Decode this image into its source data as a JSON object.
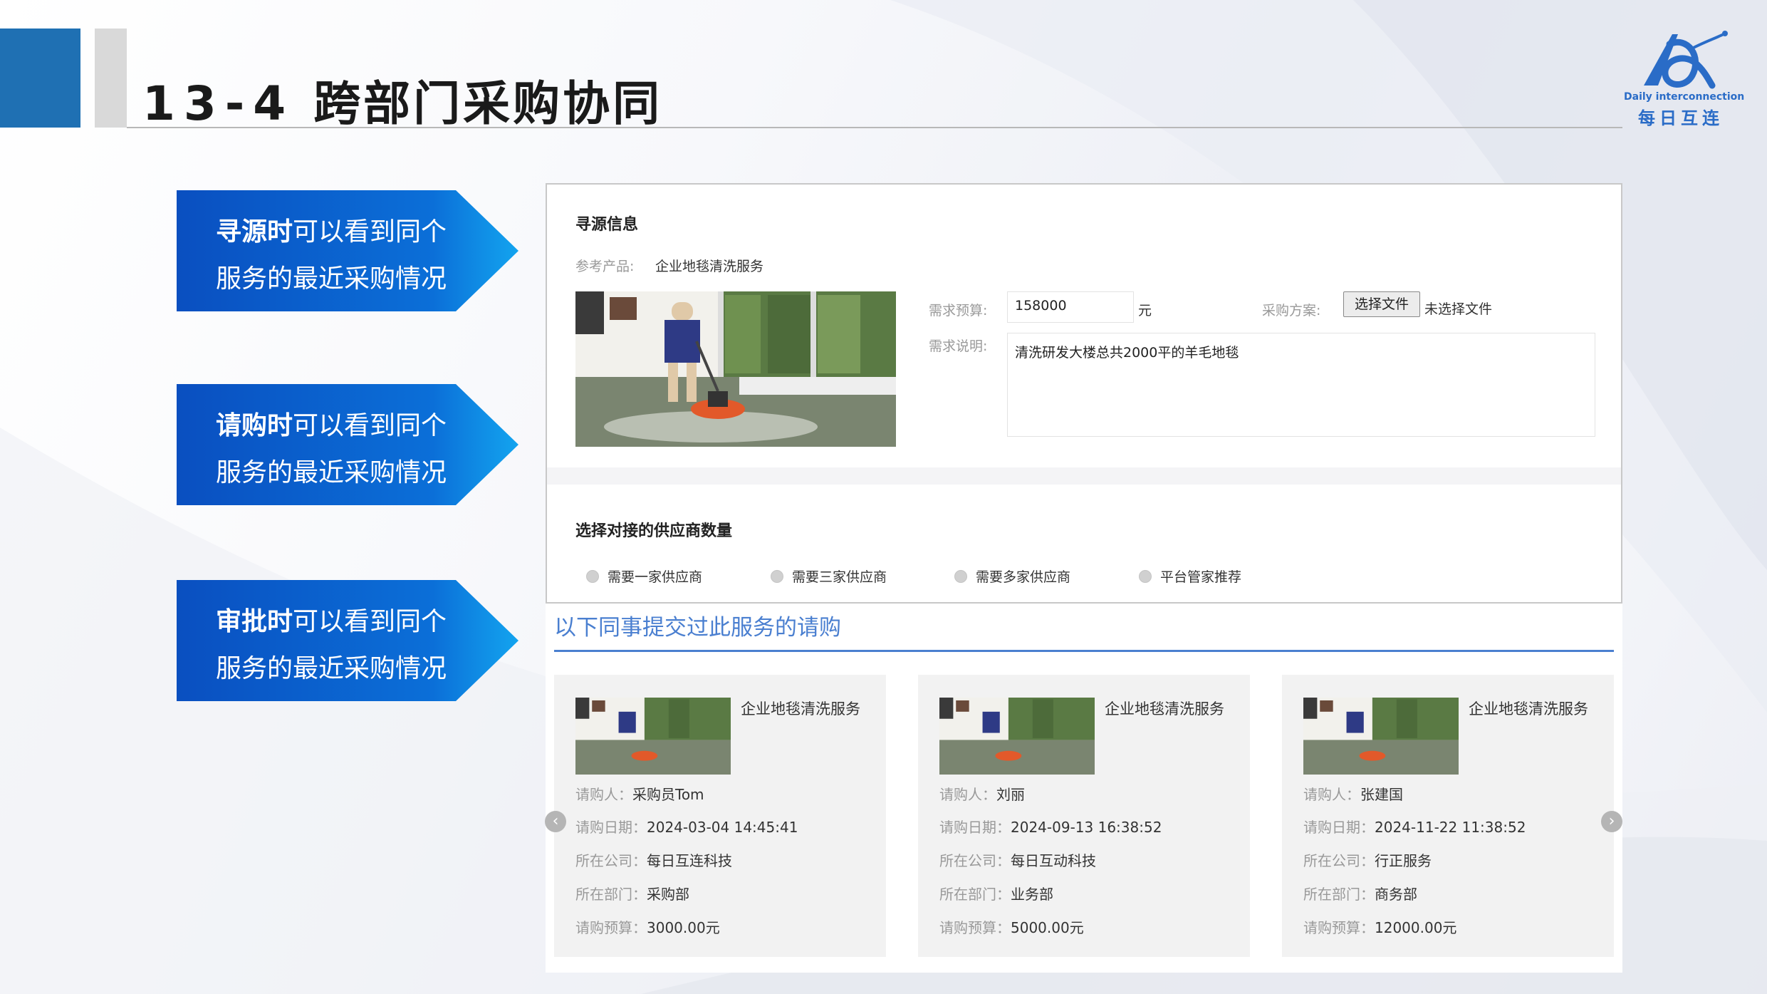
{
  "header": {
    "title_num": "13-4",
    "title_text": "跨部门采购协同"
  },
  "logo": {
    "en": "Daily interconnection",
    "cn": "每日互连"
  },
  "callouts": [
    {
      "bold": "寻源时",
      "rest": "可以看到同个",
      "line2": "服务的最近采购情况"
    },
    {
      "bold": "请购时",
      "rest": "可以看到同个",
      "line2": "服务的最近采购情况"
    },
    {
      "bold": "审批时",
      "rest": "可以看到同个",
      "line2": "服务的最近采购情况"
    }
  ],
  "sourcing": {
    "section_title": "寻源信息",
    "ref_product_label": "参考产品:",
    "ref_product_value": "企业地毯清洗服务",
    "budget_label": "需求预算:",
    "budget_value": "158000",
    "budget_unit": "元",
    "plan_label": "采购方案:",
    "file_button": "选择文件",
    "file_status": "未选择文件",
    "desc_label": "需求说明:",
    "desc_value": "清洗研发大楼总共2000平的羊毛地毯"
  },
  "supplier": {
    "section_title": "选择对接的供应商数量",
    "options": [
      "需要一家供应商",
      "需要三家供应商",
      "需要多家供应商",
      "平台管家推荐"
    ]
  },
  "colleagues": {
    "title": "以下同事提交过此服务的请购",
    "labels": {
      "requester": "请购人：",
      "date": "请购日期：",
      "company": "所在公司：",
      "dept": "所在部门：",
      "budget": "请购预算："
    },
    "cards": [
      {
        "product": "企业地毯清洗服务",
        "requester": "采购员Tom",
        "date": "2024-03-04 14:45:41",
        "company": "每日互连科技",
        "dept": "采购部",
        "budget": "3000.00元"
      },
      {
        "product": "企业地毯清洗服务",
        "requester": "刘丽",
        "date": "2024-09-13 16:38:52",
        "company": "每日互动科技",
        "dept": "业务部",
        "budget": "5000.00元"
      },
      {
        "product": "企业地毯清洗服务",
        "requester": "张建国",
        "date": "2024-11-22 11:38:52",
        "company": "行正服务",
        "dept": "商务部",
        "budget": "12000.00元"
      }
    ]
  }
}
